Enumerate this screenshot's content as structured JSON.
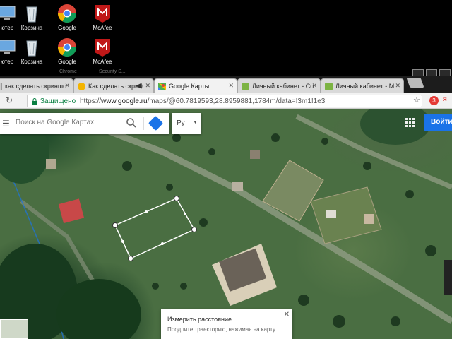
{
  "desktop": {
    "row1": [
      {
        "label": "ютер",
        "icon": "computer-icon"
      },
      {
        "label": "Корзина",
        "icon": "recycle-bin-icon"
      },
      {
        "label": "Google",
        "icon": "chrome-icon"
      },
      {
        "label": "McAfee",
        "icon": "mcafee-icon"
      }
    ],
    "row2": [
      {
        "label": "ютер",
        "icon": "computer-icon"
      },
      {
        "label": "Корзина",
        "icon": "recycle-bin-icon"
      },
      {
        "label": "Google",
        "icon": "chrome-icon"
      },
      {
        "label": "McAfee",
        "icon": "mcafee-icon"
      }
    ],
    "row2_sub": [
      "Chrome",
      "Security S..."
    ]
  },
  "tabs": [
    {
      "label": "как сделать скриншо",
      "favicon": "page-icon",
      "active": false
    },
    {
      "label": "Как сделать скрин",
      "favicon": "youtube-icon",
      "active": false,
      "audio": true
    },
    {
      "label": "Google Карты",
      "favicon": "google-maps-icon",
      "active": true
    },
    {
      "label": "Личный кабинет - Со",
      "favicon": "page-icon",
      "active": false
    },
    {
      "label": "Личный кабинет - М",
      "favicon": "page-icon",
      "active": false
    }
  ],
  "address": {
    "secure_label": "Защищено",
    "url_scheme": "https://",
    "url_host": "www.google.ru",
    "url_path": "/maps/@60.7819593,28.8959881,1784m/data=!3m1!1e3"
  },
  "extensions": {
    "red_badge": "3",
    "yandex": "я"
  },
  "search": {
    "placeholder": "Поиск на Google Картах",
    "lang": "Ру"
  },
  "signin_label": "Войти",
  "measure": {
    "title": "Измерить расстояние",
    "hint": "Продлите траекторию, нажимая на карту"
  },
  "colors": {
    "accent": "#1a73e8",
    "secure_green": "#0b8043",
    "measure_line": "#ffffff"
  }
}
